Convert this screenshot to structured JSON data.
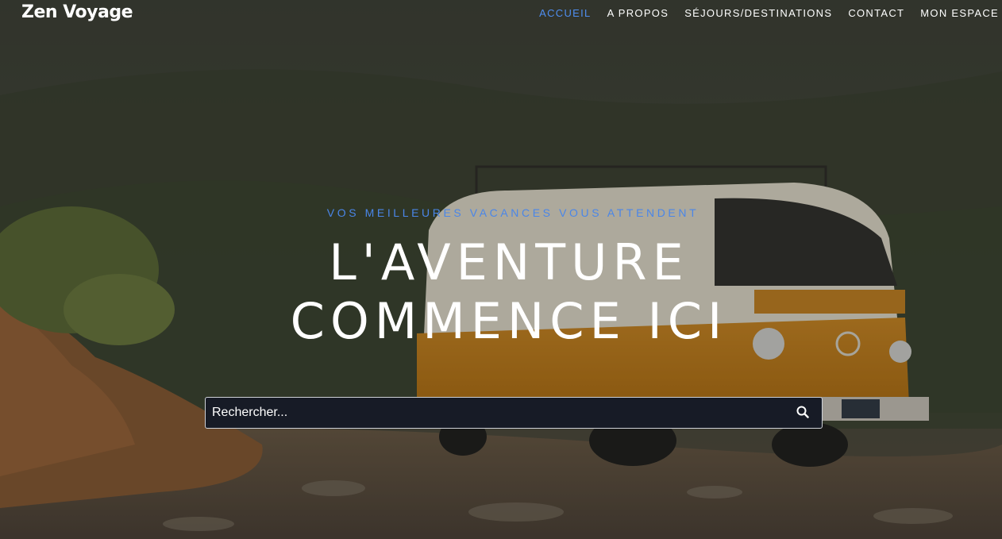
{
  "brand": {
    "name": "Zen Voyage"
  },
  "nav": {
    "items": [
      {
        "label": "ACCUEIL",
        "active": true
      },
      {
        "label": "A PROPOS",
        "active": false
      },
      {
        "label": "SÉJOURS/DESTINATIONS",
        "active": false
      },
      {
        "label": "CONTACT",
        "active": false
      },
      {
        "label": "MON ESPACE",
        "active": false
      }
    ]
  },
  "hero": {
    "tagline": "VOS MEILLEURES VACANCES VOUS ATTENDENT",
    "headline_line1": "L'AVENTURE",
    "headline_line2": "COMMENCE ICI",
    "background_image": "orange-vintage-van-in-forest"
  },
  "search": {
    "placeholder": "Rechercher...",
    "value": "",
    "icon": "search-icon"
  },
  "colors": {
    "accent": "#4a86e8",
    "text": "#ffffff",
    "search_bg": "#171b26"
  }
}
